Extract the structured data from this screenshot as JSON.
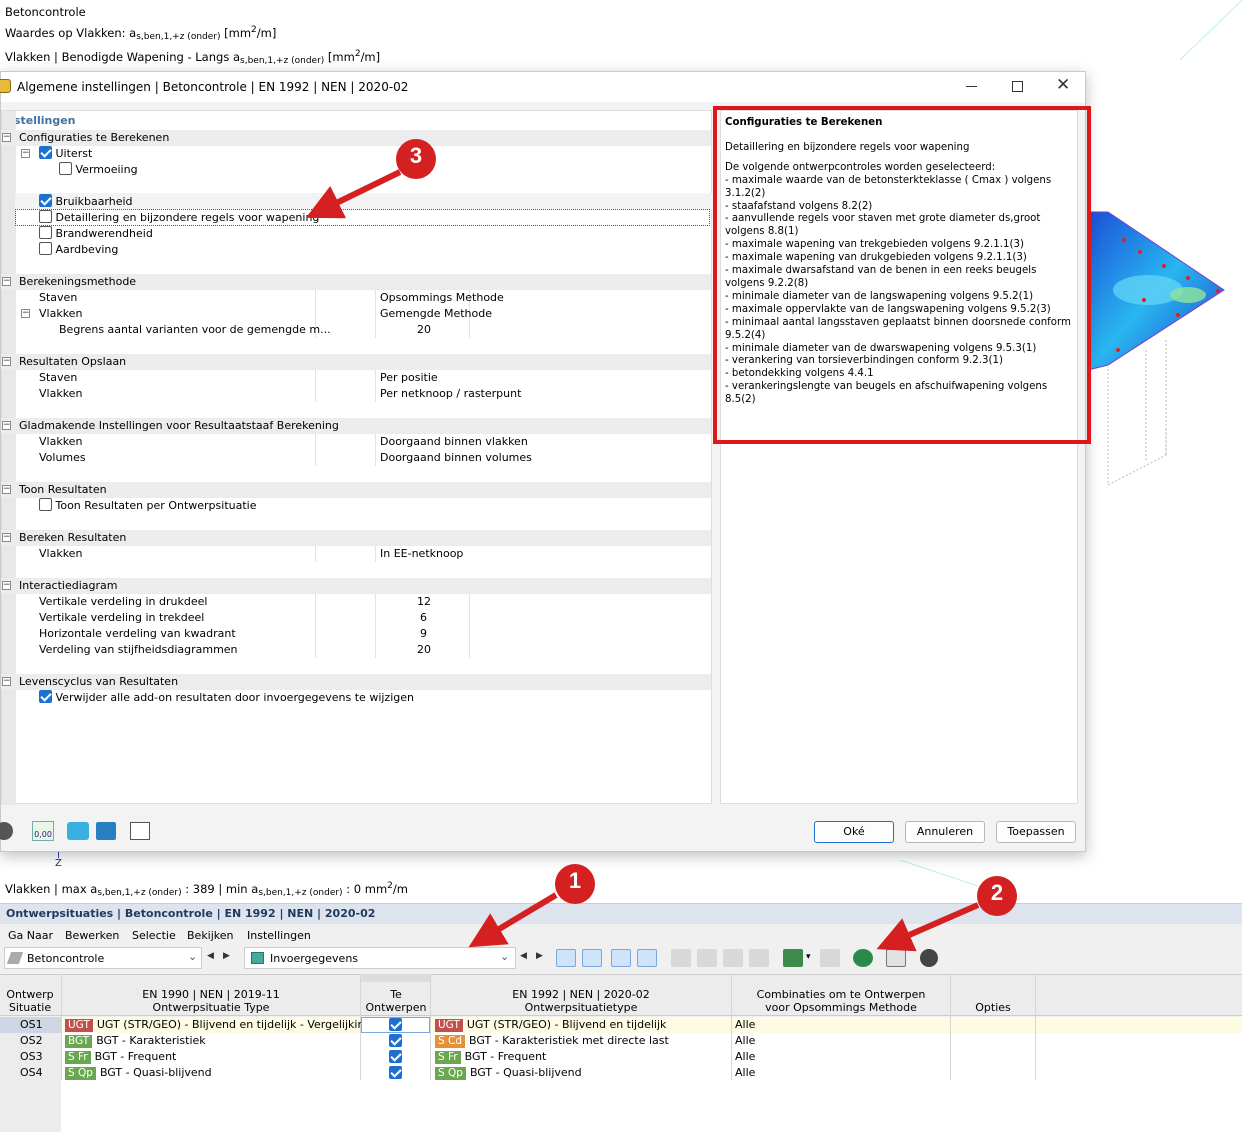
{
  "viewport": {
    "line1": "Betoncontrole",
    "line2_pre": "Waardes op Vlakken: a",
    "line2_sub": "s,ben,1,+z (onder)",
    "line2_unit_a": " [mm",
    "line2_unit_sup": "2",
    "line2_unit_b": "/m]",
    "line3_pre": "Vlakken | Benodigde Wapening - Langs a",
    "line3_sub": "s,ben,1,+z (onder)",
    "line3_unit_a": " [mm",
    "line3_unit_sup": "2",
    "line3_unit_b": "/m]",
    "axis_z": "Z",
    "status_pre": "Vlakken | max a",
    "status_sub1": "s,ben,1,+z (onder)",
    "status_mid": " : 389 | min a",
    "status_sub2": "s,ben,1,+z (onder)",
    "status_end_a": " : 0 mm",
    "status_sup": "2",
    "status_end_b": "/m"
  },
  "dialog": {
    "title": "Algemene instellingen | Betoncontrole | EN 1992 | NEN | 2020-02",
    "panel_header": "Instellingen",
    "sections": {
      "config": "Configuraties te Berekenen",
      "methode": "Berekeningsmethode",
      "opslaan": "Resultaten Opslaan",
      "glad": "Gladmakende Instellingen voor Resultaatstaaf Berekening",
      "toon": "Toon Resultaten",
      "bereken": "Bereken Resultaten",
      "interactie": "Interactiediagram",
      "levens": "Levenscyclus van Resultaten"
    },
    "config_items": {
      "uiterst": "Uiterst",
      "vermoeiing": "Vermoeiing",
      "bruik": "Bruikbaarheid",
      "detail": "Detaillering en bijzondere regels voor wapening",
      "brand": "Brandwerendheid",
      "aard": "Aardbeving"
    },
    "methode": {
      "staven": "Staven",
      "staven_val": "Opsommings Methode",
      "vlakken": "Vlakken",
      "vlakken_val": "Gemengde Methode",
      "begrens": "Begrens aantal varianten voor de gemengde m...",
      "begrens_val": "20"
    },
    "opslaan": {
      "staven": "Staven",
      "staven_val": "Per positie",
      "vlakken": "Vlakken",
      "vlakken_val": "Per netknoop / rasterpunt"
    },
    "glad": {
      "vlakken": "Vlakken",
      "vlakken_val": "Doorgaand binnen vlakken",
      "volumes": "Volumes",
      "volumes_val": "Doorgaand binnen volumes"
    },
    "toon": {
      "item": "Toon Resultaten per Ontwerpsituatie"
    },
    "bereken": {
      "vlakken": "Vlakken",
      "vlakken_val": "In EE-netknoop"
    },
    "interactie": {
      "r1": "Vertikale verdeling in drukdeel",
      "v1": "12",
      "r2": "Vertikale verdeling in trekdeel",
      "v2": "6",
      "r3": "Horizontale verdeling van kwadrant",
      "v3": "9",
      "r4": "Verdeling van stijfheidsdiagrammen",
      "v4": "20"
    },
    "levens": {
      "item": "Verwijder alle add-on resultaten door invoergegevens te wijzigen"
    },
    "info": {
      "title": "Configuraties te Berekenen",
      "subtitle": "Detaillering en bijzondere regels voor wapening",
      "intro": "De volgende ontwerpcontroles worden geselecteerd:",
      "lines": [
        "- maximale waarde van de betonsterkteklasse ( Cmax ) volgens",
        "3.1.2(2)",
        "- staafafstand volgens 8.2(2)",
        "- aanvullende regels voor staven met grote diameter ds,groot",
        "volgens 8.8(1)",
        "- maximale wapening van trekgebieden volgens 9.2.1.1(3)",
        "- maximale wapening van drukgebieden volgens 9.2.1.1(3)",
        "- maximale dwarsafstand van de benen in een reeks beugels",
        "volgens 9.2.2(8)",
        "- minimale diameter van de langswapening volgens 9.5.2(1)",
        "- maximale oppervlakte van de langswapening volgens 9.5.2(3)",
        "- minimaal aantal langsstaven geplaatst binnen doorsnede conform",
        "9.5.2(4)",
        "- minimale diameter van de dwarswapening volgens 9.5.3(1)",
        "- verankering van torsieverbindingen conform 9.2.3(1)",
        "- betondekking volgens 4.4.1",
        "- verankeringslengte van beugels en afschuifwapening volgens",
        "8.5(2)"
      ]
    },
    "buttons": {
      "ok": "Oké",
      "cancel": "Annuleren",
      "apply": "Toepassen"
    },
    "footer_value": "0,00"
  },
  "bottom": {
    "title": "Ontwerpsituaties | Betoncontrole | EN 1992 | NEN | 2020-02",
    "menu": [
      "Ga Naar",
      "Bewerken",
      "Selectie",
      "Bekijken",
      "Instellingen"
    ],
    "combo1": "Betoncontrole",
    "combo2": "Invoergegevens",
    "headers": {
      "h1a": "Ontwerp",
      "h1b": "Situatie",
      "h2a": "EN 1990 | NEN | 2019-11",
      "h2b": "Ontwerpsituatie Type",
      "h3a": "Te",
      "h3b": "Ontwerpen",
      "h4a": "EN 1992 | NEN | 2020-02",
      "h4b": "Ontwerpsituatietype",
      "h5a": "Combinaties om te Ontwerpen",
      "h5b": "voor Opsommings Methode",
      "h6": "Opties"
    },
    "rows": [
      {
        "id": "OS1",
        "tag1": "UGT",
        "t1color": "#c0504d",
        "type1": "UGT (STR/GEO) - Blijvend en tijdelijk - Vergelijkin...",
        "tag2": "UGT",
        "t2color": "#c0504d",
        "type2": "UGT (STR/GEO) - Blijvend en tijdelijk",
        "comb": "Alle"
      },
      {
        "id": "OS2",
        "tag1": "BGT",
        "t1color": "#6aa84f",
        "type1": "BGT - Karakteristiek",
        "tag2": "S Cd",
        "t2color": "#e69138",
        "type2": "BGT - Karakteristiek met directe last",
        "comb": "Alle"
      },
      {
        "id": "OS3",
        "tag1": "S Fr",
        "t1color": "#6aa84f",
        "type1": "BGT - Frequent",
        "tag2": "S Fr",
        "t2color": "#6aa84f",
        "type2": "BGT - Frequent",
        "comb": "Alle"
      },
      {
        "id": "OS4",
        "tag1": "S Qp",
        "t1color": "#6aa84f",
        "type1": "BGT - Quasi-blijvend",
        "tag2": "S Qp",
        "t2color": "#6aa84f",
        "type2": "BGT - Quasi-blijvend",
        "comb": "Alle"
      }
    ]
  },
  "callouts": [
    "1",
    "2",
    "3"
  ],
  "colors": {
    "callout": "#d42020",
    "highlight_box": "#e0161b",
    "check": "#1f6fd1"
  }
}
